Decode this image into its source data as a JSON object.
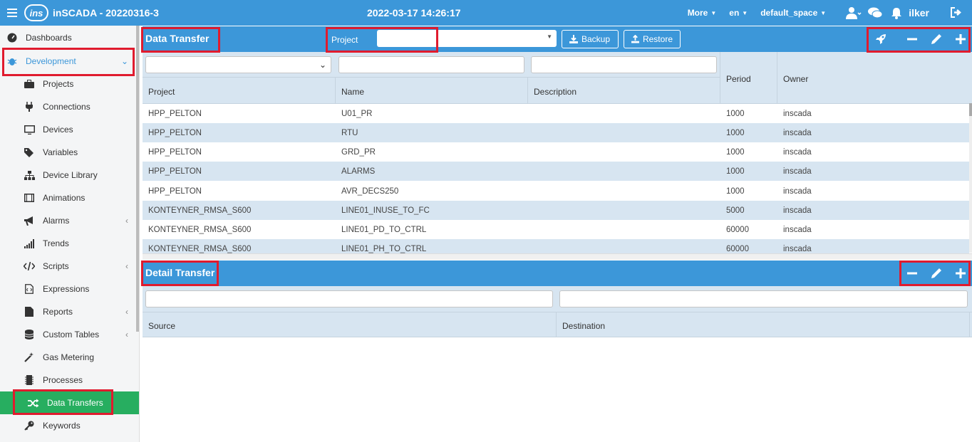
{
  "topbar": {
    "title": "inSCADA - 20220316-3",
    "logo_text": "ins",
    "datetime": "2022-03-17 14:26:17",
    "more": "More",
    "language": "en",
    "space": "default_space",
    "user": "ilker"
  },
  "sidebar": {
    "items": [
      {
        "label": "Dashboards",
        "icon": "dashboard-icon"
      },
      {
        "label": "Development",
        "icon": "bug-icon"
      },
      {
        "label": "Projects",
        "icon": "briefcase-icon"
      },
      {
        "label": "Connections",
        "icon": "plug-icon"
      },
      {
        "label": "Devices",
        "icon": "monitor-icon"
      },
      {
        "label": "Variables",
        "icon": "tags-icon"
      },
      {
        "label": "Device Library",
        "icon": "sitemap-icon"
      },
      {
        "label": "Animations",
        "icon": "film-icon"
      },
      {
        "label": "Alarms",
        "icon": "bullhorn-icon"
      },
      {
        "label": "Trends",
        "icon": "signal-icon"
      },
      {
        "label": "Scripts",
        "icon": "code-icon"
      },
      {
        "label": "Expressions",
        "icon": "file-code-icon"
      },
      {
        "label": "Reports",
        "icon": "file-icon"
      },
      {
        "label": "Custom Tables",
        "icon": "database-icon"
      },
      {
        "label": "Gas Metering",
        "icon": "magic-icon"
      },
      {
        "label": "Processes",
        "icon": "microchip-icon"
      },
      {
        "label": "Data Transfers",
        "icon": "random-icon"
      },
      {
        "label": "Keywords",
        "icon": "key-icon"
      }
    ]
  },
  "data_transfer": {
    "title": "Data Transfer",
    "project_label": "Project",
    "project_value": "",
    "backup_label": "Backup",
    "restore_label": "Restore",
    "columns": [
      "Project",
      "Name",
      "Description",
      "Period",
      "Owner"
    ],
    "rows": [
      {
        "project": "HPP_PELTON",
        "name": "U01_PR",
        "description": "",
        "period": "1000",
        "owner": "inscada"
      },
      {
        "project": "HPP_PELTON",
        "name": "RTU",
        "description": "",
        "period": "1000",
        "owner": "inscada"
      },
      {
        "project": "HPP_PELTON",
        "name": "GRD_PR",
        "description": "",
        "period": "1000",
        "owner": "inscada"
      },
      {
        "project": "HPP_PELTON",
        "name": "ALARMS",
        "description": "",
        "period": "1000",
        "owner": "inscada"
      },
      {
        "project": "HPP_PELTON",
        "name": "AVR_DECS250",
        "description": "",
        "period": "1000",
        "owner": "inscada"
      },
      {
        "project": "KONTEYNER_RMSA_S600",
        "name": "LINE01_INUSE_TO_FC",
        "description": "",
        "period": "5000",
        "owner": "inscada"
      },
      {
        "project": "KONTEYNER_RMSA_S600",
        "name": "LINE01_PD_TO_CTRL",
        "description": "",
        "period": "60000",
        "owner": "inscada"
      },
      {
        "project": "KONTEYNER_RMSA_S600",
        "name": "LINE01_PH_TO_CTRL",
        "description": "",
        "period": "60000",
        "owner": "inscada"
      }
    ]
  },
  "detail_transfer": {
    "title": "Detail Transfer",
    "columns": [
      "Source",
      "Destination"
    ]
  }
}
